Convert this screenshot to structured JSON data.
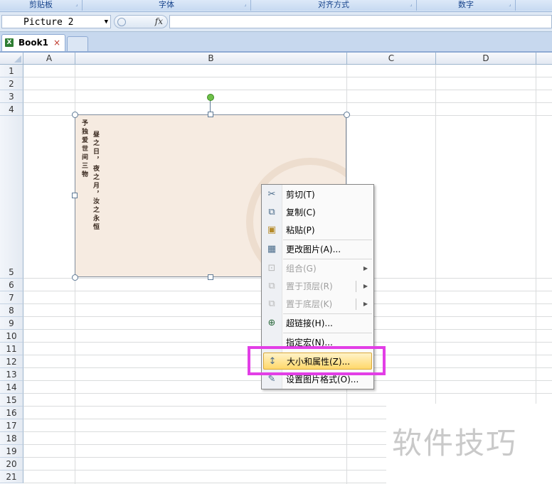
{
  "ribbon": {
    "groups": [
      "剪贴板",
      "字体",
      "对齐方式",
      "数字"
    ]
  },
  "formula_bar": {
    "name_box_value": "Picture 2",
    "fx_label": "fx",
    "formula_value": ""
  },
  "tabs": {
    "book_tab": "Book1",
    "close_glyph": "×"
  },
  "sheet": {
    "columns": [
      "A",
      "B",
      "C",
      "D"
    ],
    "rows": [
      "1",
      "2",
      "3",
      "4",
      "5",
      "6",
      "7",
      "8",
      "9",
      "10",
      "11",
      "12",
      "13",
      "14",
      "15",
      "16",
      "17",
      "18",
      "19",
      "20",
      "21"
    ]
  },
  "picture": {
    "name": "Picture 2",
    "poem_columns": [
      "予独爱世间三物",
      "昼之日，夜之月，",
      "汝之永恒"
    ]
  },
  "context_menu": {
    "items": [
      {
        "label": "剪切(T)",
        "icon": "scissors-icon",
        "enabled": true
      },
      {
        "label": "复制(C)",
        "icon": "copy-icon",
        "enabled": true
      },
      {
        "label": "粘贴(P)",
        "icon": "paste-icon",
        "enabled": true
      },
      {
        "label": "更改图片(A)...",
        "icon": "change-picture-icon",
        "enabled": true
      },
      {
        "label": "组合(G)",
        "icon": "group-icon",
        "enabled": false
      },
      {
        "label": "置于顶层(R)",
        "icon": "bring-to-front-icon",
        "enabled": false
      },
      {
        "label": "置于底层(K)",
        "icon": "send-to-back-icon",
        "enabled": false
      },
      {
        "label": "超链接(H)...",
        "icon": "hyperlink-icon",
        "enabled": true
      },
      {
        "label": "指定宏(N)...",
        "icon": "",
        "enabled": true
      },
      {
        "label": "大小和属性(Z)...",
        "icon": "size-properties-icon",
        "enabled": true,
        "highlighted": true
      },
      {
        "label": "设置图片格式(O)...",
        "icon": "format-picture-icon",
        "enabled": true
      }
    ]
  },
  "watermark": "软件技巧",
  "colors": {
    "highlight_box": "#e23ee6",
    "menu_hover": "#ffd86b",
    "picture_bg": "#f6ebe1"
  }
}
